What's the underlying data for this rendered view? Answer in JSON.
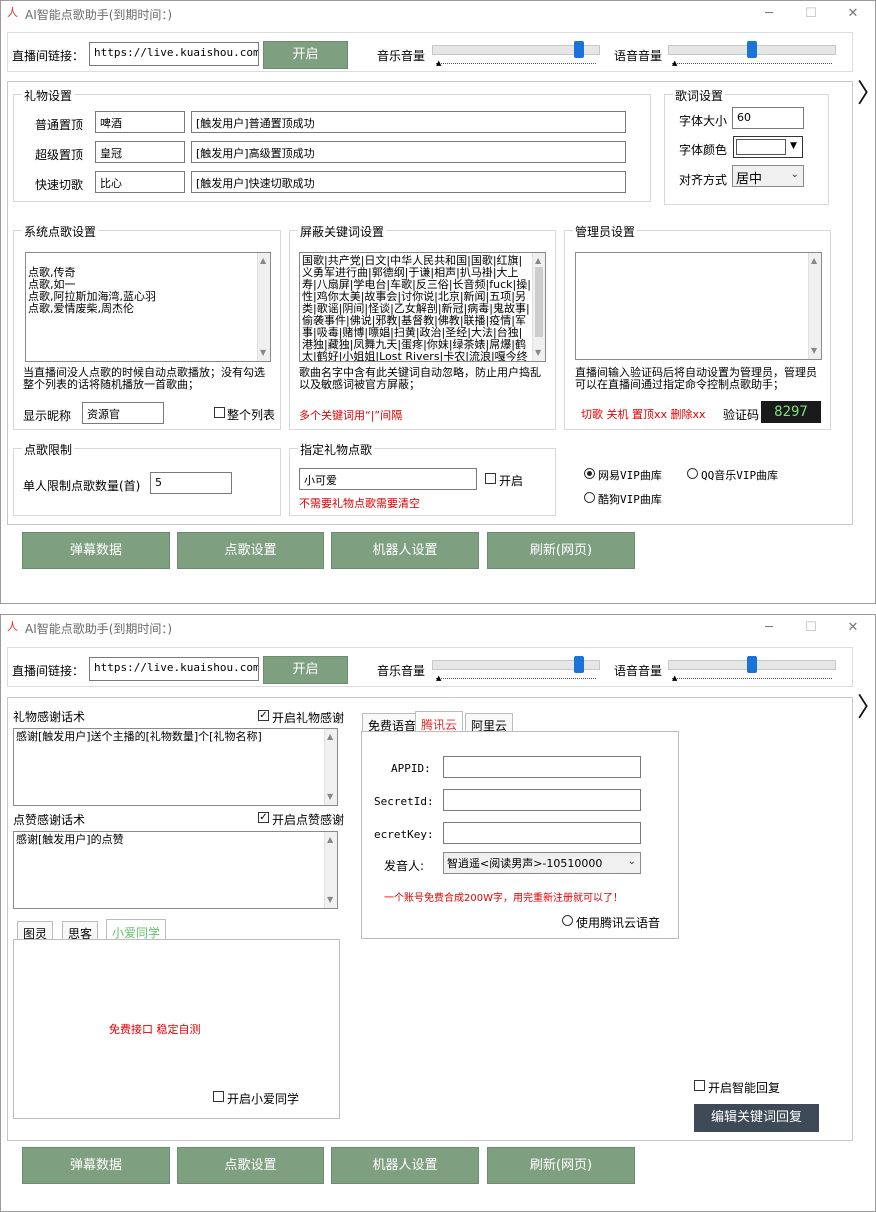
{
  "app": {
    "title": "AI智能点歌助手(到期时间：)",
    "logo": "人",
    "min": "─",
    "max": "☐",
    "close": "✕"
  },
  "top": {
    "url_label": "直播间链接：",
    "url_value": "https://live.kuaishou.com/u/3x",
    "start_button": "开启",
    "music_volume_label": "音乐音量",
    "music_volume_level": 0.9,
    "voice_volume_label": "语音音量",
    "voice_volume_level": 0.5
  },
  "nav": {
    "next_icon": "〉"
  },
  "gift_settings": {
    "legend": "礼物设置",
    "rows": [
      {
        "label": "普通置顶",
        "gift": "啤酒",
        "message": "[触发用户]普通置顶成功"
      },
      {
        "label": "超级置顶",
        "gift": "皇冠",
        "message": "[触发用户]高级置顶成功"
      },
      {
        "label": "快速切歌",
        "gift": "比心",
        "message": "[触发用户]快速切歌成功"
      }
    ]
  },
  "lyrics": {
    "legend": "歌词设置",
    "font_size_label": "字体大小",
    "font_size_value": "60",
    "font_color_label": "字体颜色",
    "align_label": "对齐方式",
    "align_value": "居中"
  },
  "system_songs": {
    "legend": "系统点歌设置",
    "list": "点歌,传奇\n点歌,如一\n点歌,阿拉斯加海湾,蓝心羽\n点歌,爱情废柴,周杰伦",
    "hint": "当直播间没人点歌的时候自动点歌播放；没有勾选整个列表的话将随机播放一首歌曲；",
    "nickname_label": "显示昵称",
    "nickname_value": "资源官",
    "whole_list_label": "整个列表"
  },
  "blocked": {
    "legend": "屏蔽关键词设置",
    "list": "国歌|共产党|日文|中华人民共和国|国歌|红旗|义勇军进行曲|郭德纲|于谦|相声|扒马褂|大上寿|八扇屏|学电台|车歌|反三俗|长音频|fuck|操|性|鸡你太美|故事会|讨你说|北京|新闻|五项|另类|歌谣|阴间|怪谈|乙女解剖|新冠|病毒|鬼故事|偷袭事件|佛说|邪教|基督教|佛教|联播|疫情|军事|吸毒|赌博|嘌娼|扫黄|政治|圣经|大法|台独|港独|藏独|凤舞九天|蛋疼|你妹|绿茶婊|屌爆|鹤太|鹤好|小姐姐|Lost Rivers|卡农|流浪|嘎今终",
    "hint": "歌曲名字中含有此关键词自动忽略，防止用户捣乱以及敏感词被官方屏蔽；",
    "red_hint": "多个关键词用“|”间隔"
  },
  "admin": {
    "legend": "管理员设置",
    "list": "",
    "hint": "直播间输入验证码后将自动设置为管理员，管理员可以在直播间通过指定命令控制点歌助手；",
    "commands": "切歌  关机  置顶xx  删除xx",
    "code_label": "验证码",
    "code_value": "8297"
  },
  "limit": {
    "legend": "点歌限制",
    "label": "单人限制点歌数量(首)",
    "value": "5"
  },
  "gift_song": {
    "legend": "指定礼物点歌",
    "value": "小可爱",
    "enable_label": "开启",
    "red_hint": "不需要礼物点歌需要清空"
  },
  "vip": {
    "netease": "网易VIP曲库",
    "qq": "QQ音乐VIP曲库",
    "kugou": "酷狗VIP曲库",
    "selected": "netease"
  },
  "bottom_buttons": [
    "弹幕数据",
    "点歌设置",
    "机器人设置",
    "刷新(网页)"
  ],
  "robot": {
    "gift_thanks_label": "礼物感谢话术",
    "gift_thanks_enable": "开启礼物感谢",
    "gift_thanks_text": "感谢[触发用户]送个主播的[礼物数量]个[礼物名称]",
    "like_thanks_label": "点赞感谢话术",
    "like_thanks_enable": "开启点赞感谢",
    "like_thanks_text": "感谢[触发用户]的点赞",
    "tabs": [
      "图灵",
      "思客",
      "小爱同学"
    ],
    "tab_content": "免费接口  稳定自测",
    "xiaoai_enable": "开启小爱同学",
    "voice_tabs": [
      "免费语音",
      "腾讯云",
      "阿里云"
    ],
    "appid_label": "APPID:",
    "secretid_label": "SecretId:",
    "secretkey_label": "ecretKey:",
    "speaker_label": "发音人:",
    "speaker_value": "智逍遥<阅读男声>-10510000",
    "voice_note": "一个账号免费合成200W字，用完重新注册就可以了！",
    "use_tencent": "使用腾讯云语音",
    "smart_reply": "开启智能回复",
    "edit_reply_button": "编辑关键词回复"
  }
}
